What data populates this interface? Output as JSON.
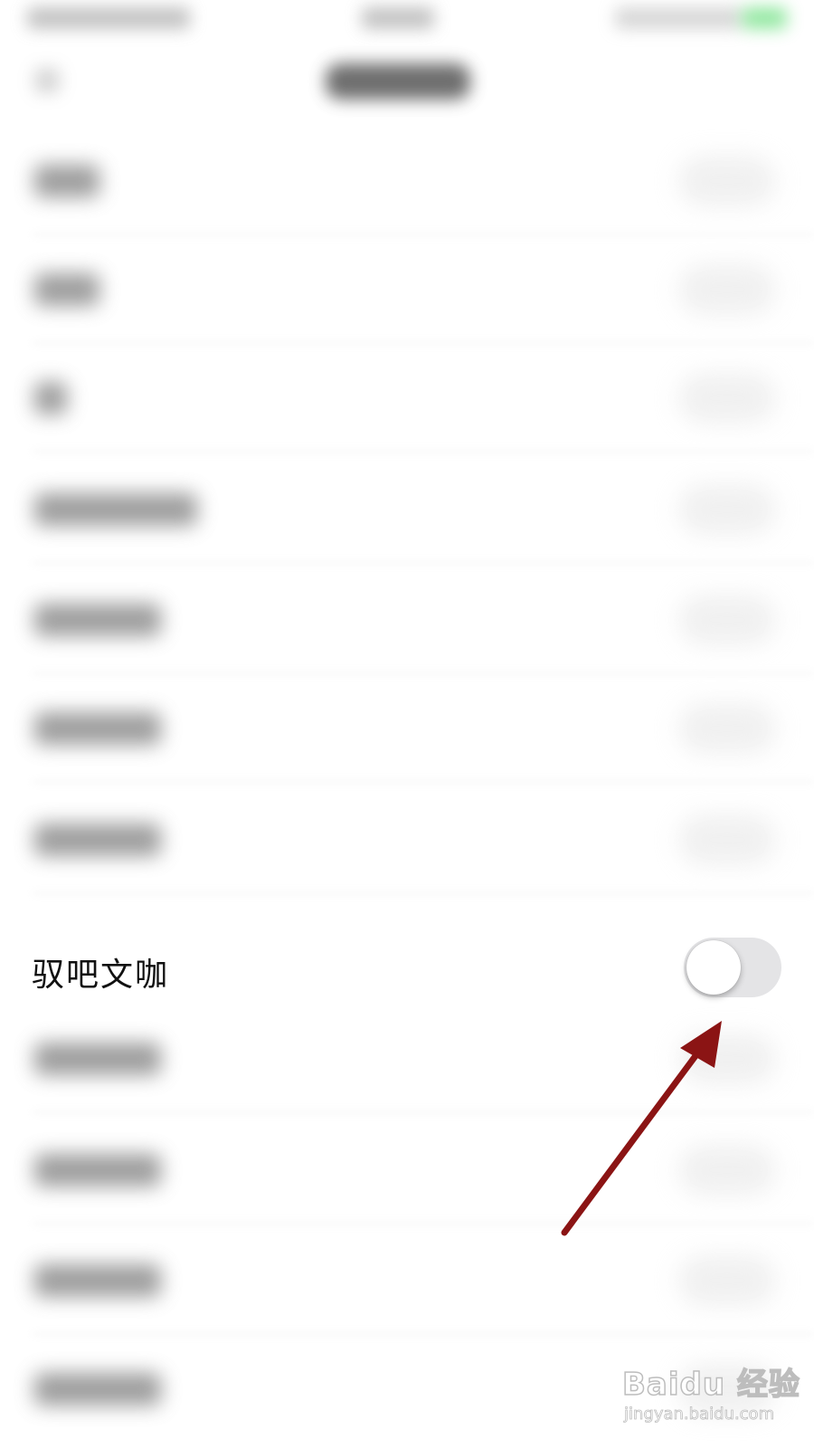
{
  "setting": {
    "label": "驭吧文咖",
    "enabled": false
  },
  "watermark": {
    "logo": "Baidu 经验",
    "site": "jingyan.baidu.com"
  },
  "colors": {
    "arrow": "#8b1414",
    "toggle_off_track": "#e4e4e6",
    "status_green": "#4cd964"
  }
}
